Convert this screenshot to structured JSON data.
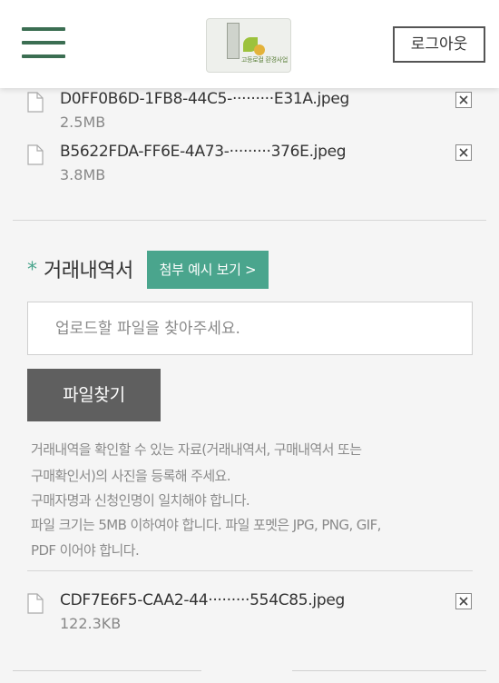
{
  "header": {
    "logo_text": "고등로컬 환경사업",
    "logout_label": "로그아웃"
  },
  "uploaded_files_top": [
    {
      "name": "D0FF0B6D-1FB8-44C5-·········E31A.jpeg",
      "size": "2.5MB"
    },
    {
      "name": "B5622FDA-FF6E-4A73-·········376E.jpeg",
      "size": "3.8MB"
    }
  ],
  "transaction_section": {
    "required_mark": "*",
    "title": "거래내역서",
    "example_button": "첨부 예시 보기 >",
    "upload_placeholder": "업로드할 파일을 찾아주세요.",
    "find_button": "파일찾기",
    "notes": [
      "거래내역을 확인할 수 있는 자료(거래내역서, 구매내역서 또는",
      "구매확인서)의 사진을 등록해 주세요.",
      "구매자명과 신청인명이 일치해야 합니다.",
      "파일 크기는 5MB 이하여야 합니다. 파일 포멧은 JPG, PNG, GIF,",
      "PDF 이어야 합니다."
    ],
    "uploaded_files": [
      {
        "name": "CDF7E6F5-CAA2-44·········554C85.jpeg",
        "size": "122.3KB"
      }
    ]
  },
  "colors": {
    "accent": "#4aa58d",
    "menu_icon": "#3b6e52",
    "find_button_bg": "#5f5f5f"
  },
  "icons": [
    "hamburger-menu-icon",
    "file-icon",
    "close-icon"
  ]
}
